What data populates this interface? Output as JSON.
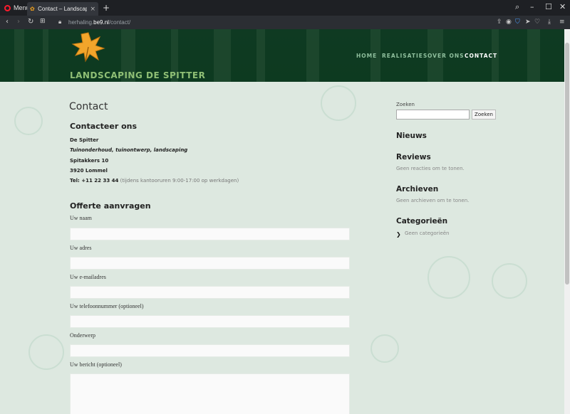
{
  "browser": {
    "menu_label": "Menu",
    "tab_title": "Contact – Landscaping De",
    "url_prefix": "herhaling.",
    "url_domain": "be9.nl",
    "url_path": "/contact/"
  },
  "site": {
    "title": "LANDSCAPING DE SPITTER",
    "nav": [
      "HOME",
      "REALISATIES",
      "OVER ONS",
      "CONTACT"
    ]
  },
  "page": {
    "title": "Contact",
    "contact_heading": "Contacteer ons",
    "address": {
      "name": "De Spitter",
      "tagline": "Tuinonderhoud, tuinontwerp, landscaping",
      "street": "Spitakkers 10",
      "city": "3920 Lommel",
      "phone": "Tel: +11 22 33 44",
      "hours": " (tijdens kantooruren 9:00-17:00 op werkdagen)"
    },
    "form_heading": "Offerte aanvragen",
    "fields": [
      "Uw naam",
      "Uw adres",
      "Uw e-mailadres",
      "Uw telefoonnummer (optioneel)",
      "Onderwerp",
      "Uw bericht (optioneel)"
    ]
  },
  "sidebar": {
    "search_label": "Zoeken",
    "search_button": "Zoeken",
    "news_title": "Nieuws",
    "reviews_title": "Reviews",
    "reviews_text": "Geen reacties om te tonen.",
    "archives_title": "Archieven",
    "archives_text": "Geen archieven om te tonen.",
    "categories_title": "Categorieën",
    "categories_text": "Geen categorieën"
  },
  "colors": {
    "header_bg": "#0f3a22",
    "title_green": "#8fbf75",
    "page_bg": "#dde8e0"
  }
}
